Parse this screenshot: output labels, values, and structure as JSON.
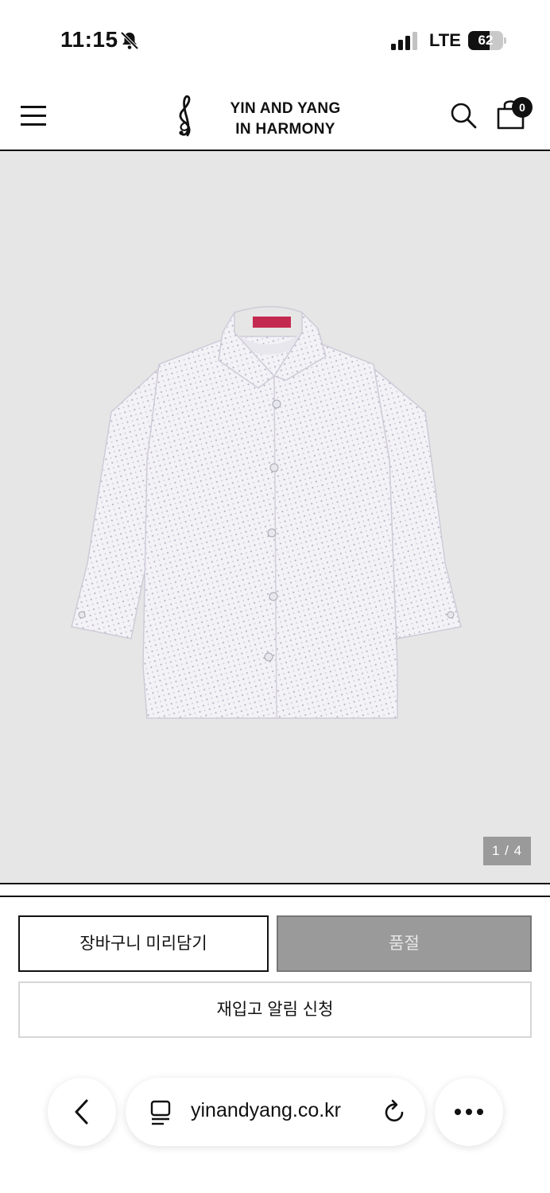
{
  "status_bar": {
    "time": "11:15",
    "network": "LTE",
    "battery_level": "62",
    "battery_fraction": 0.62
  },
  "header": {
    "logo_line1": "YIN AND YANG",
    "logo_line2": "IN HARMONY",
    "cart_count": "0",
    "icons": [
      "menu-icon",
      "treble-clef-logo-icon",
      "search-icon",
      "shopping-bag-icon"
    ]
  },
  "product": {
    "image_counter": "1 / 4",
    "background_color": "#e6e6e6"
  },
  "actions": {
    "add_to_cart_label": "장바구니 미리담기",
    "sold_out_label": "품절",
    "restock_label": "재입고 알림 신청"
  },
  "browser": {
    "url": "yinandyang.co.kr",
    "icons": [
      "back-icon",
      "tab-icon",
      "reload-icon",
      "more-icon"
    ]
  }
}
